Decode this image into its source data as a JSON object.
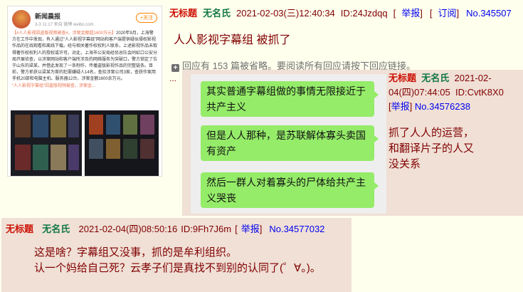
{
  "weibo": {
    "account_name": "新闻晨报",
    "meta": "3-3 11:17 来自 微博 weibo.com",
    "follow_label": "+关注",
    "hashtag": "【#人人影视因盗版视频被查#，涉案金额超1600万元】",
    "body": "2020年9月，上海警方在工作中发现，有人通过“人人影视字幕组”网站和客户端提供疑似侵权影视作品的在线观看和离线下载。经与相关著作权权利人联系，上述影视作品未取得著作权权利人的授权或许可。对此，上海市公安局经侦总队会同虹口公安分局开展侦查，以涉案网站和客户端所涉及的网络服务为突破口，警方锁定了位于山东的梁某，并借此发现了一条制作、传播盗版影视作品的完整链条。目前，警方抓获以梁某为首的犯罪嫌疑人14名，查扣涉案公司3家，查获作案用手机20部和电脑主机、服务器12台，涉案金额1600余万元。",
    "video_caption": "“人人影视字幕组”因盗版视频被查，涉案金..."
  },
  "post": {
    "title_label": "无标题",
    "name": "无名氏",
    "datetime": "2021-02-03(三)12:40:34",
    "id": "ID:24Jzdqq",
    "report": "举报",
    "subscribe": "订阅",
    "number": "No.345507",
    "body": "人人影视字幕组 被抓了"
  },
  "omitted": {
    "plus": "+",
    "prefix": "回应有",
    "count": "153",
    "suffix": "篇被省略。要阅读所有回应请按下回应链接。"
  },
  "ellipsis": "...",
  "reply1": {
    "title_label": "无标题",
    "name": "无名氏",
    "datetime_a": "2021-02-",
    "datetime_b": "04(四)07:44:05",
    "id": "ID:CvtK8X0",
    "report": "举报",
    "number": "No.34576238",
    "body": [
      "抓了人人的运营，",
      "和翻译片子的人又",
      "没关系"
    ],
    "chat": [
      "其实普通字幕组做的事情无限接近于共产主义",
      "但是人人那种，是苏联解体寡头卖国有资产",
      "然后一群人对着寡头的尸体给共产主义哭丧"
    ]
  },
  "reply2": {
    "title_label": "无标题",
    "name": "无名氏",
    "datetime": "2021-02-04(四)08:50:16",
    "id": "ID:9Fh7J6m",
    "report": "举报",
    "number": "No.34577032",
    "body": [
      "这是啥？字幕组又没事，抓的是牟利组织。",
      "认一个妈给自己死？云孝子们是真找不到别的认同了(゜∀。)。"
    ]
  }
}
